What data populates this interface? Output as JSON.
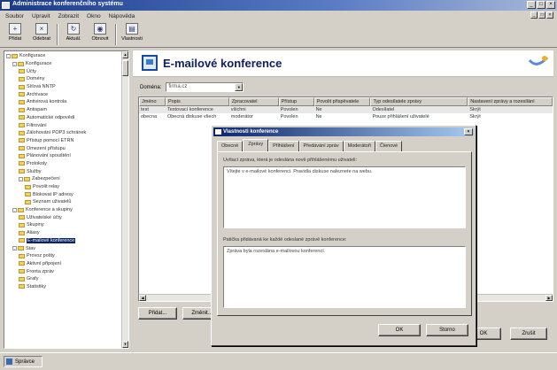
{
  "window": {
    "title": "Administrace konferenčního systému"
  },
  "window_buttons": [
    "_",
    "□",
    "×"
  ],
  "menubar": [
    "Soubor",
    "Upravit",
    "Zobrazit",
    "Okno",
    "Nápověda"
  ],
  "toolbar": [
    {
      "label": "Přidat",
      "icon": "add-icon"
    },
    {
      "label": "Odebrat",
      "icon": "remove-icon"
    },
    {
      "label": "Aktuál.",
      "icon": "refresh-icon"
    },
    {
      "label": "Obnovit",
      "icon": "restore-icon"
    },
    {
      "label": "Vlastnosti",
      "icon": "properties-icon"
    }
  ],
  "tree": [
    {
      "label": "Konfigurace",
      "depth": 0,
      "expander": "-"
    },
    {
      "label": "Konfigurace",
      "depth": 1,
      "expander": "-"
    },
    {
      "label": "Účty",
      "depth": 2
    },
    {
      "label": "Domény",
      "depth": 2
    },
    {
      "label": "Síťová NNTP",
      "depth": 2
    },
    {
      "label": "Archivace",
      "depth": 2
    },
    {
      "label": "Antivirová kontrola",
      "depth": 2
    },
    {
      "label": "Antispam",
      "depth": 2
    },
    {
      "label": "Automatické odpovědi",
      "depth": 2
    },
    {
      "label": "Filtrování",
      "depth": 2
    },
    {
      "label": "Zálohování POP3 schránek",
      "depth": 2
    },
    {
      "label": "Přístup pomocí ETRN",
      "depth": 2
    },
    {
      "label": "Omezení přístupu",
      "depth": 2
    },
    {
      "label": "Plánování spouštění",
      "depth": 2
    },
    {
      "label": "Protokoly",
      "depth": 2
    },
    {
      "label": "Služby",
      "depth": 2
    },
    {
      "label": "Zabezpečení",
      "depth": 2,
      "expander": "-"
    },
    {
      "label": "Povolit relay",
      "depth": 3
    },
    {
      "label": "Blokovat IP adresy",
      "depth": 3
    },
    {
      "label": "Seznam uživatelů",
      "depth": 3
    },
    {
      "label": "Konference a skupiny",
      "depth": 1,
      "expander": "-"
    },
    {
      "label": "Uživatelské účty",
      "depth": 2
    },
    {
      "label": "Skupiny",
      "depth": 2
    },
    {
      "label": "Aliasy",
      "depth": 2
    },
    {
      "label": "E-mailové konference",
      "depth": 2,
      "selected": true
    },
    {
      "label": "Stav",
      "depth": 1,
      "expander": "-"
    },
    {
      "label": "Provoz pošty",
      "depth": 2
    },
    {
      "label": "Aktivní připojení",
      "depth": 2
    },
    {
      "label": "Fronta zpráv",
      "depth": 2
    },
    {
      "label": "Grafy",
      "depth": 2
    },
    {
      "label": "Statistiky",
      "depth": 2
    }
  ],
  "status": {
    "label": "Správce"
  },
  "header": {
    "title": "E-mailové konference"
  },
  "filter": {
    "label": "Doména:",
    "value": "firma.cz"
  },
  "grid": {
    "columns": [
      "Jméno",
      "Popis",
      "Zpracovatel",
      "Přístup",
      "Povolit přispěvatele",
      "Typ odesílatele zprávy",
      "Nastavení zprávy a rozesílání"
    ],
    "rows": [
      [
        "test",
        "Testovací konference",
        "všichni",
        "Povolen",
        "Ne",
        "Odesílatel",
        "Skrýt"
      ],
      [
        "obecna",
        "Obecná diskuse všech",
        "moderátor",
        "Povolen",
        "Ne",
        "Pouze přihlášení uživatelé",
        "Skrýt"
      ]
    ]
  },
  "content_buttons": {
    "add": "Přidat...",
    "edit": "Změnit...",
    "ok": "OK",
    "cancel": "Zrušit"
  },
  "dialog": {
    "title": "Vlastnosti konference",
    "close": "×",
    "tabs": [
      "Obecné",
      "Zprávy",
      "Přihlášení",
      "Předávání zpráv",
      "Moderátoři",
      "Členové"
    ],
    "active_tab": 1,
    "label1": "Uvítací zpráva, která je odeslána nově přihlášenému uživateli:",
    "value1": "Vítejte v e-mailové konferenci. Pravidla diskuse naleznete na webu.",
    "label2": "Patička přidávaná ke každé odeslané zprávě konference:",
    "value2": "Zpráva byla rozeslána e-mailovou konferencí.",
    "ok": "OK",
    "cancel": "Storno"
  }
}
